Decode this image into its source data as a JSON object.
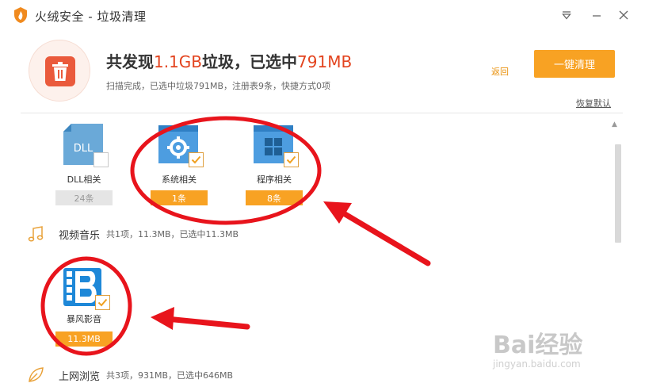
{
  "window": {
    "title": "火绒安全 - 垃圾清理",
    "menu_icon": "triangle-menu-icon",
    "minimize_icon": "minimize-icon",
    "close_icon": "close-icon"
  },
  "summary": {
    "headline_prefix": "共发现",
    "found_size": "1.1GB",
    "headline_middle": "垃圾，已选中",
    "selected_size": "791MB",
    "subline": "扫描完成，已选中垃圾791MB，注册表9条，快捷方式0项",
    "back_label": "返回",
    "clean_button_label": "一键清理",
    "restore_default_label": "恢复默认"
  },
  "items": [
    {
      "name": "DLL相关",
      "count": "24条",
      "checked": false,
      "icon": "dll-file-icon",
      "icon_text": "DLL"
    },
    {
      "name": "系统相关",
      "count": "1条",
      "checked": true,
      "icon": "system-gear-icon"
    },
    {
      "name": "程序相关",
      "count": "8条",
      "checked": true,
      "icon": "program-grid-icon"
    }
  ],
  "categories": [
    {
      "name": "视频音乐",
      "detail": "共1项，11.3MB，已选中11.3MB",
      "icon": "music-note-icon"
    },
    {
      "name": "上网浏览",
      "detail": "共3项，931MB，已选中646MB",
      "icon": "browser-leaf-icon"
    }
  ],
  "video_items": [
    {
      "name": "暴风影音",
      "size": "11.3MB",
      "checked": true,
      "icon": "baofeng-player-icon"
    }
  ],
  "watermark": {
    "logo_text": "Bai经验",
    "sub_text": "jingyan.baidu.com"
  },
  "colors": {
    "accent_orange": "#f8a223",
    "highlight_red": "#e3441f",
    "annotation_red": "#e8141c"
  }
}
